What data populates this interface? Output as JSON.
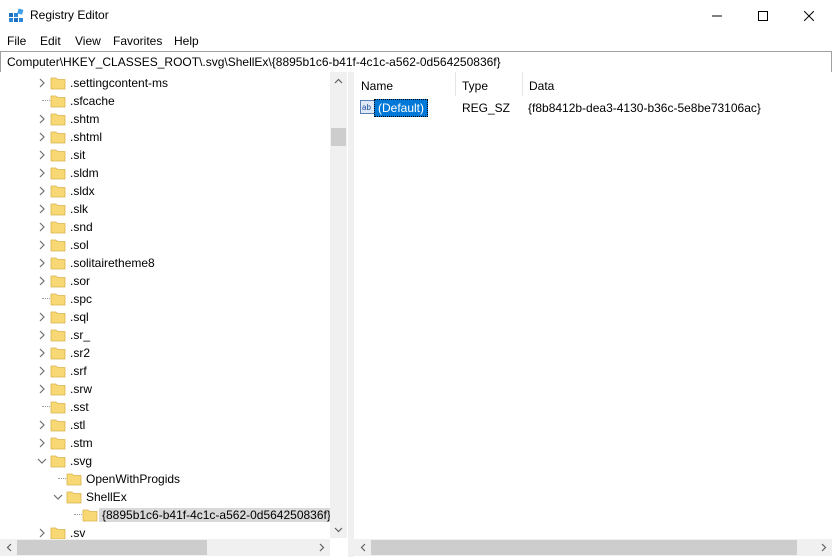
{
  "window": {
    "title": "Registry Editor",
    "minimize_icon": "minimize-icon",
    "maximize_icon": "maximize-icon",
    "close_icon": "close-icon"
  },
  "menu": [
    "File",
    "Edit",
    "View",
    "Favorites",
    "Help"
  ],
  "address": "Computer\\HKEY_CLASSES_ROOT\\.svg\\ShellEx\\{8895b1c6-b41f-4c1c-a562-0d564250836f}",
  "tree": [
    {
      "label": ".settingcontent-ms",
      "expander": "collapsed"
    },
    {
      "label": ".sfcache",
      "expander": "none"
    },
    {
      "label": ".shtm",
      "expander": "collapsed"
    },
    {
      "label": ".shtml",
      "expander": "collapsed"
    },
    {
      "label": ".sit",
      "expander": "collapsed"
    },
    {
      "label": ".sldm",
      "expander": "collapsed"
    },
    {
      "label": ".sldx",
      "expander": "collapsed"
    },
    {
      "label": ".slk",
      "expander": "collapsed"
    },
    {
      "label": ".snd",
      "expander": "collapsed"
    },
    {
      "label": ".sol",
      "expander": "collapsed"
    },
    {
      "label": ".solitairetheme8",
      "expander": "collapsed"
    },
    {
      "label": ".sor",
      "expander": "collapsed"
    },
    {
      "label": ".spc",
      "expander": "none"
    },
    {
      "label": ".sql",
      "expander": "collapsed"
    },
    {
      "label": ".sr_",
      "expander": "collapsed"
    },
    {
      "label": ".sr2",
      "expander": "collapsed"
    },
    {
      "label": ".srf",
      "expander": "collapsed"
    },
    {
      "label": ".srw",
      "expander": "collapsed"
    },
    {
      "label": ".sst",
      "expander": "none"
    },
    {
      "label": ".stl",
      "expander": "collapsed"
    },
    {
      "label": ".stm",
      "expander": "collapsed"
    },
    {
      "label": ".svg",
      "expander": "expanded"
    },
    {
      "label": "OpenWithProgids",
      "expander": "none",
      "level": 1
    },
    {
      "label": "ShellEx",
      "expander": "expanded",
      "level": 1
    },
    {
      "label": "{8895b1c6-b41f-4c1c-a562-0d564250836f}",
      "expander": "none",
      "level": 2,
      "selected": true
    },
    {
      "label": ".sv",
      "expander": "collapsed"
    }
  ],
  "columns": [
    "Name",
    "Type",
    "Data"
  ],
  "values": [
    {
      "name": "(Default)",
      "type": "REG_SZ",
      "data": "{f8b8412b-dea3-4130-b36c-5e8be73106ac}",
      "icon": "string-value-icon"
    }
  ],
  "colors": {
    "selection": "#0078d7",
    "folder": "#f8d775",
    "tree_selected": "#d9d9d9"
  }
}
